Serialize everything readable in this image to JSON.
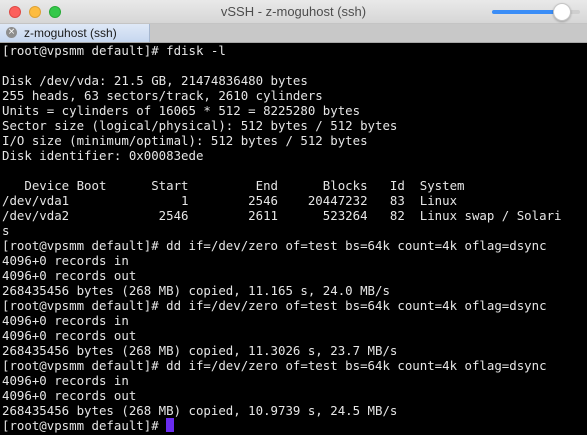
{
  "window": {
    "title": "vSSH - z-moguhost (ssh)"
  },
  "toolbar": {
    "font_size_slider_level": 0.8
  },
  "tabs": [
    {
      "label": "z-moguhost (ssh)",
      "active": true
    }
  ],
  "terminal": {
    "lines": [
      "[root@vpsmm default]# fdisk -l",
      "",
      "Disk /dev/vda: 21.5 GB, 21474836480 bytes",
      "255 heads, 63 sectors/track, 2610 cylinders",
      "Units = cylinders of 16065 * 512 = 8225280 bytes",
      "Sector size (logical/physical): 512 bytes / 512 bytes",
      "I/O size (minimum/optimal): 512 bytes / 512 bytes",
      "Disk identifier: 0x00083ede",
      "",
      "   Device Boot      Start         End      Blocks   Id  System",
      "/dev/vda1               1        2546    20447232   83  Linux",
      "/dev/vda2            2546        2611      523264   82  Linux swap / Solari",
      "s",
      "[root@vpsmm default]# dd if=/dev/zero of=test bs=64k count=4k oflag=dsync",
      "4096+0 records in",
      "4096+0 records out",
      "268435456 bytes (268 MB) copied, 11.165 s, 24.0 MB/s",
      "[root@vpsmm default]# dd if=/dev/zero of=test bs=64k count=4k oflag=dsync",
      "4096+0 records in",
      "4096+0 records out",
      "268435456 bytes (268 MB) copied, 11.3026 s, 23.7 MB/s",
      "[root@vpsmm default]# dd if=/dev/zero of=test bs=64k count=4k oflag=dsync",
      "4096+0 records in",
      "4096+0 records out",
      "268435456 bytes (268 MB) copied, 10.9739 s, 24.5 MB/s"
    ],
    "prompt": "[root@vpsmm default]# "
  },
  "colors": {
    "background": "#000000",
    "foreground": "#e6e6e6",
    "cursor": "#6a2cf0",
    "slider_accent": "#3b8df6"
  }
}
